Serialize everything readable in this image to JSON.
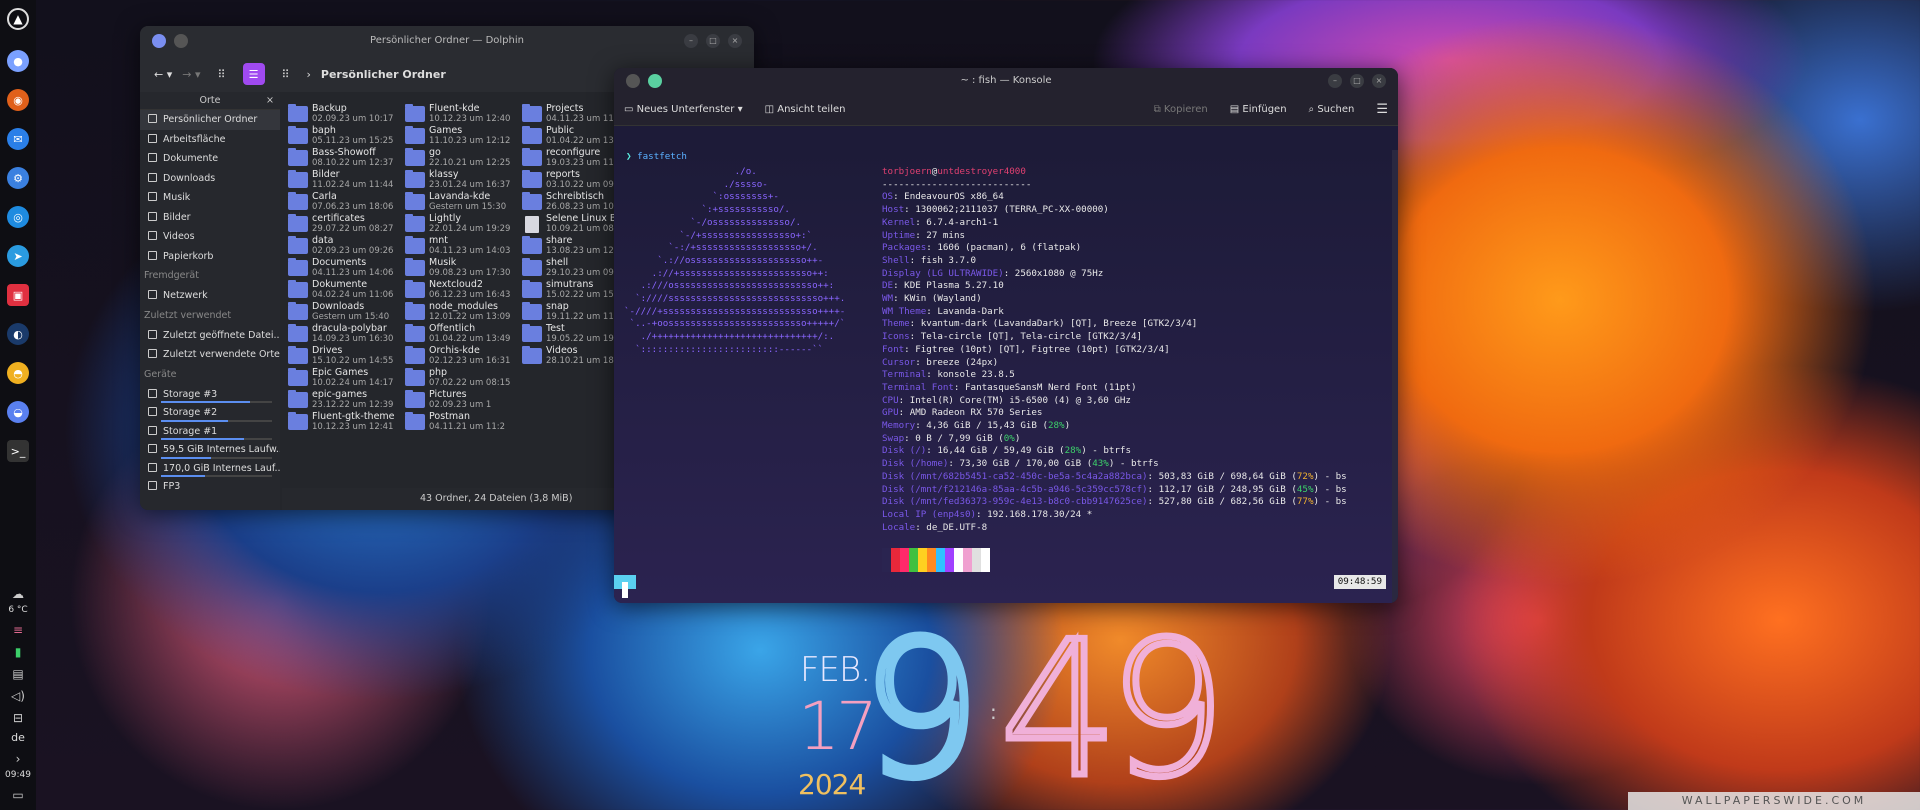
{
  "panel": {
    "temp": "6 °C",
    "lang": "de",
    "time": "09:49"
  },
  "dolphin": {
    "title": "Persönlicher Ordner — Dolphin",
    "breadcrumb": "Persönlicher Ordner",
    "sidebar_header": "Orte",
    "places": [
      "Persönlicher Ordner",
      "Arbeitsfläche",
      "Dokumente",
      "Downloads",
      "Musik",
      "Bilder",
      "Videos",
      "Papierkorb"
    ],
    "remote_header": "Fremdgerät",
    "remote": [
      "Netzwerk"
    ],
    "recent_header": "Zuletzt verwendet",
    "recent": [
      "Zuletzt geöffnete Datei...",
      "Zuletzt verwendete Orte"
    ],
    "devices_header": "Geräte",
    "devices": [
      {
        "name": "Storage #3",
        "used": 0.8
      },
      {
        "name": "Storage #2",
        "used": 0.6
      },
      {
        "name": "Storage #1",
        "used": 0.75
      },
      {
        "name": "59,5 GiB Internes Laufw...",
        "used": 0.45
      },
      {
        "name": "170,0 GiB Internes Lauf...",
        "used": 0.4
      },
      {
        "name": "FP3",
        "used": 0
      }
    ],
    "files": [
      {
        "name": "Backup",
        "date": "02.09.23 um 10:17",
        "kind": "folder"
      },
      {
        "name": "baph",
        "date": "05.11.23 um 15:25",
        "kind": "folder"
      },
      {
        "name": "Bass-Showoff",
        "date": "08.10.22 um 12:37",
        "kind": "folder"
      },
      {
        "name": "Bilder",
        "date": "11.02.24 um 11:44",
        "kind": "folder"
      },
      {
        "name": "Carla",
        "date": "07.06.23 um 18:06",
        "kind": "folder"
      },
      {
        "name": "certificates",
        "date": "29.07.22 um 08:27",
        "kind": "folder"
      },
      {
        "name": "data",
        "date": "02.09.23 um 09:26",
        "kind": "folder"
      },
      {
        "name": "Documents",
        "date": "04.11.23 um 14:06",
        "kind": "folder"
      },
      {
        "name": "Dokumente",
        "date": "04.02.24 um 11:06",
        "kind": "folder"
      },
      {
        "name": "Downloads",
        "date": "Gestern um 15:40",
        "kind": "folder"
      },
      {
        "name": "dracula-polybar",
        "date": "14.09.23 um 16:30",
        "kind": "folder"
      },
      {
        "name": "Drives",
        "date": "15.10.22 um 14:55",
        "kind": "folder"
      },
      {
        "name": "Epic Games",
        "date": "10.02.24 um 14:17",
        "kind": "folder"
      },
      {
        "name": "epic-games",
        "date": "23.12.22 um 12:39",
        "kind": "folder"
      },
      {
        "name": "Fluent-gtk-theme",
        "date": "10.12.23 um 12:41",
        "kind": "folder"
      },
      {
        "name": "Fluent-kde",
        "date": "10.12.23 um 12:40",
        "kind": "folder"
      },
      {
        "name": "Games",
        "date": "11.10.23 um 12:12",
        "kind": "folder"
      },
      {
        "name": "go",
        "date": "22.10.21 um 12:25",
        "kind": "folder"
      },
      {
        "name": "klassy",
        "date": "23.01.24 um 16:37",
        "kind": "folder"
      },
      {
        "name": "Lavanda-kde",
        "date": "Gestern um 15:30",
        "kind": "folder"
      },
      {
        "name": "Lightly",
        "date": "22.01.24 um 19:29",
        "kind": "folder"
      },
      {
        "name": "mnt",
        "date": "04.11.23 um 14:03",
        "kind": "folder"
      },
      {
        "name": "Musik",
        "date": "09.08.23 um 17:30",
        "kind": "folder"
      },
      {
        "name": "Nextcloud2",
        "date": "06.12.23 um 16:43",
        "kind": "folder"
      },
      {
        "name": "node_modules",
        "date": "12.01.22 um 13:09",
        "kind": "folder"
      },
      {
        "name": "Öffentlich",
        "date": "01.04.22 um 13:49",
        "kind": "folder"
      },
      {
        "name": "Orchis-kde",
        "date": "02.12.23 um 16:31",
        "kind": "folder"
      },
      {
        "name": "php",
        "date": "07.02.22 um 08:15",
        "kind": "folder"
      },
      {
        "name": "Pictures",
        "date": "02.09.23 um 1",
        "kind": "folder"
      },
      {
        "name": "Postman",
        "date": "04.11.21 um 11:2",
        "kind": "folder"
      },
      {
        "name": "Projects",
        "date": "04.11.23 um 11:0",
        "kind": "folder"
      },
      {
        "name": "Public",
        "date": "01.04.22 um 13:",
        "kind": "folder"
      },
      {
        "name": "reconfigure",
        "date": "19.03.23 um 11:5",
        "kind": "folder"
      },
      {
        "name": "reports",
        "date": "03.10.22 um 09:",
        "kind": "folder"
      },
      {
        "name": "Schreibtisch",
        "date": "26.08.23 um 10:",
        "kind": "folder"
      },
      {
        "name": "Selene Linux Ba",
        "date": "10.09.21 um 08:",
        "kind": "doc"
      },
      {
        "name": "share",
        "date": "13.08.23 um 12:",
        "kind": "folder"
      },
      {
        "name": "shell",
        "date": "29.10.23 um 09:",
        "kind": "folder"
      },
      {
        "name": "simutrans",
        "date": "15.02.22 um 15:2",
        "kind": "folder"
      },
      {
        "name": "snap",
        "date": "19.11.22 um 11:3",
        "kind": "folder"
      },
      {
        "name": "Test",
        "date": "19.05.22 um 19:1",
        "kind": "folder"
      },
      {
        "name": "Videos",
        "date": "28.10.21 um 18:",
        "kind": "folder"
      }
    ],
    "status": "43 Ordner, 24 Dateien (3,8 MiB)"
  },
  "konsole": {
    "title": "~ : fish — Konsole",
    "new_tab": "Neues Unterfenster",
    "split": "Ansicht teilen",
    "copy": "Kopieren",
    "paste": "Einfügen",
    "search": "Suchen",
    "prompt_mark": "❯",
    "command": "fastfetch",
    "user": "torbjoern",
    "host": "untdestroyer4000",
    "separator": "---------------------------",
    "info": [
      {
        "k": "OS",
        "v": "EndeavourOS x86_64"
      },
      {
        "k": "Host",
        "v": "1300062;2111037 (TERRA_PC-XX-00000)"
      },
      {
        "k": "Kernel",
        "v": "6.7.4-arch1-1"
      },
      {
        "k": "Uptime",
        "v": "27 mins"
      },
      {
        "k": "Packages",
        "v": "1606 (pacman), 6 (flatpak)"
      },
      {
        "k": "Shell",
        "v": "fish 3.7.0"
      },
      {
        "k": "Display (LG ULTRAWIDE)",
        "v": "2560x1080 @ 75Hz"
      },
      {
        "k": "DE",
        "v": "KDE Plasma 5.27.10"
      },
      {
        "k": "WM",
        "v": "KWin (Wayland)"
      },
      {
        "k": "WM Theme",
        "v": "Lavanda-Dark"
      },
      {
        "k": "Theme",
        "v": "kvantum-dark (LavandaDark) [QT], Breeze [GTK2/3/4]"
      },
      {
        "k": "Icons",
        "v": "Tela-circle [QT], Tela-circle [GTK2/3/4]"
      },
      {
        "k": "Font",
        "v": "Figtree (10pt) [QT], Figtree (10pt) [GTK2/3/4]"
      },
      {
        "k": "Cursor",
        "v": "breeze (24px)"
      },
      {
        "k": "Terminal",
        "v": "konsole 23.8.5"
      },
      {
        "k": "Terminal Font",
        "v": "FantasqueSansM Nerd Font (11pt)"
      },
      {
        "k": "CPU",
        "v": "Intel(R) Core(TM) i5-6500 (4) @ 3,60 GHz"
      },
      {
        "k": "GPU",
        "v": "AMD Radeon RX 570 Series"
      },
      {
        "k": "Memory",
        "v": "4,36 GiB / 15,43 GiB (",
        "p": "28%",
        "c": "grn",
        "t": ")"
      },
      {
        "k": "Swap",
        "v": "0 B / 7,99 GiB (",
        "p": "0%",
        "c": "grn",
        "t": ")"
      },
      {
        "k": "Disk (/)",
        "v": "16,44 GiB / 59,49 GiB (",
        "p": "28%",
        "c": "grn",
        "t": ") - btrfs"
      },
      {
        "k": "Disk (/home)",
        "v": "73,30 GiB / 170,00 GiB (",
        "p": "43%",
        "c": "grn",
        "t": ") - btrfs"
      },
      {
        "k": "Disk (/mnt/682b5451-ca52-450c-be5a-5c4a2a882bca)",
        "v": "503,83 GiB / 698,64 GiB (",
        "p": "72%",
        "c": "ylw",
        "t": ") - bs"
      },
      {
        "k": "Disk (/mnt/f212146a-85aa-4c5b-a946-5c359cc578cf)",
        "v": "112,17 GiB / 248,95 GiB (",
        "p": "45%",
        "c": "grn",
        "t": ") - bs"
      },
      {
        "k": "Disk (/mnt/fed36373-959c-4e13-b8c0-cbb9147625ce)",
        "v": "527,80 GiB / 682,56 GiB (",
        "p": "77%",
        "c": "ylw",
        "t": ") - bs"
      },
      {
        "k": "Local IP (enp4s0)",
        "v": "192.168.178.30/24 *"
      },
      {
        "k": "Locale",
        "v": "de_DE.UTF-8"
      }
    ],
    "palette": [
      "#2a2450",
      "#e8283a",
      "#ff2a6a",
      "#40c040",
      "#ffd020",
      "#ff8a20",
      "#30c0ff",
      "#a040ff",
      "#ffffff",
      "#f0a0d0",
      "#e0e0e0",
      "#ffffff"
    ],
    "clock": "09:48:59",
    "logo": [
      "                    ./o.",
      "                  ./sssso-",
      "                `:osssssss+-",
      "              `:+sssssssssso/.",
      "            `-/ossssssssssssso/.",
      "          `-/+sssssssssssssssso+:`",
      "        `-:/+sssssssssssssssssso+/.",
      "      `.://osssssssssssssssssssso++-",
      "     .://+ssssssssssssssssssssssso++:",
      "   .:///ossssssssssssssssssssssssso++:",
      "  `:////ssssssssssssssssssssssssssso+++.",
      "`-////+ssssssssssssssssssssssssssso++++-",
      " `..-+oosssssssssssssssssssssssso+++++/`",
      "   ./++++++++++++++++++++++++++++++/:.",
      "  `:::::::::::::::::::::::::------``"
    ]
  },
  "clock": {
    "month": "FEB.",
    "day": "17",
    "year": "2024",
    "hour": "9",
    "minute": "49"
  },
  "watermark": "WALLPAPERSWIDE.COM"
}
